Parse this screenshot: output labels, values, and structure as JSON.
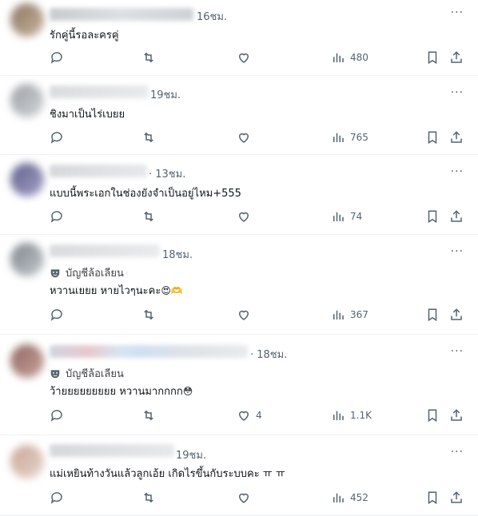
{
  "colors": {
    "icon": "#536471",
    "text": "#0f1419",
    "divider": "#eff3f4"
  },
  "icons": {
    "reply": "reply-icon",
    "repost": "repost-icon",
    "like": "heart-icon",
    "views": "views-icon",
    "bookmark": "bookmark-icon",
    "share": "share-icon",
    "more": "more-icon",
    "parody": "parody-mask-icon"
  },
  "more_glyph": "···",
  "replies": [
    {
      "time": "16ชม.",
      "text": "รักคู่นี้รอละครคู่",
      "likes": "",
      "views": "480"
    },
    {
      "time": "19ชม.",
      "text": "ชิงมาเป็นไร่เบยย",
      "likes": "",
      "views": "765"
    },
    {
      "time": "· 13ชม.",
      "text": "แบบนี้พระเอกในช่องยังจำเป็นอยู่ไหม+555",
      "likes": "",
      "views": "74"
    },
    {
      "time": "18ชม.",
      "badge": "บัญชีล้อเลียน",
      "text": "หวานเยยย หายไวๆนะคะ",
      "emoji": "😍🫶",
      "likes": "",
      "views": "367"
    },
    {
      "time": "· 18ชม.",
      "badge": "บัญชีล้อเลียน",
      "text": "ว้ายยยยยยยยย หวานมากกกก",
      "emoji": "😳",
      "likes": "4",
      "views": "1.1K"
    },
    {
      "time": "19ชม.",
      "text": "แม่เหยินท้างวันแล้วลูกเอ้ย เกิดไรขึ้นกับระบบคะ ㅠ ㅠ",
      "likes": "",
      "views": "452"
    }
  ]
}
